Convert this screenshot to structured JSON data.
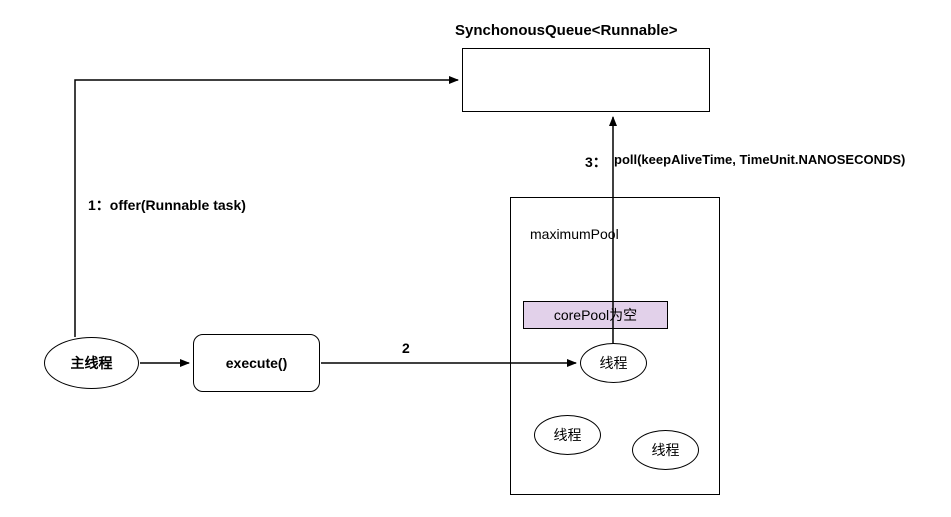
{
  "title": "SynchonousQueue<Runnable>",
  "labels": {
    "step1": "1：offer(Runnable task)",
    "step2": "2",
    "step3_num": "3：",
    "step3_text": "poll(keepAliveTime, TimeUnit.NANOSECONDS)"
  },
  "nodes": {
    "main_thread": "主线程",
    "execute": "execute()",
    "maximum_pool": "maximumPool",
    "core_pool": "corePool为空",
    "thread": "线程"
  }
}
